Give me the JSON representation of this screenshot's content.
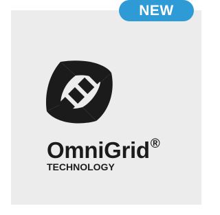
{
  "badge": {
    "label": "NEW"
  },
  "logo": {
    "icon": "omnigrid-logo-icon",
    "color": "#1b1b1b"
  },
  "brand": {
    "name": "OmniGrid",
    "mark": "®",
    "subtitle": "TECHNOLOGY"
  },
  "colors": {
    "badge": "#2f9bd6",
    "card": "#ececec",
    "text": "#1b1b1b"
  }
}
